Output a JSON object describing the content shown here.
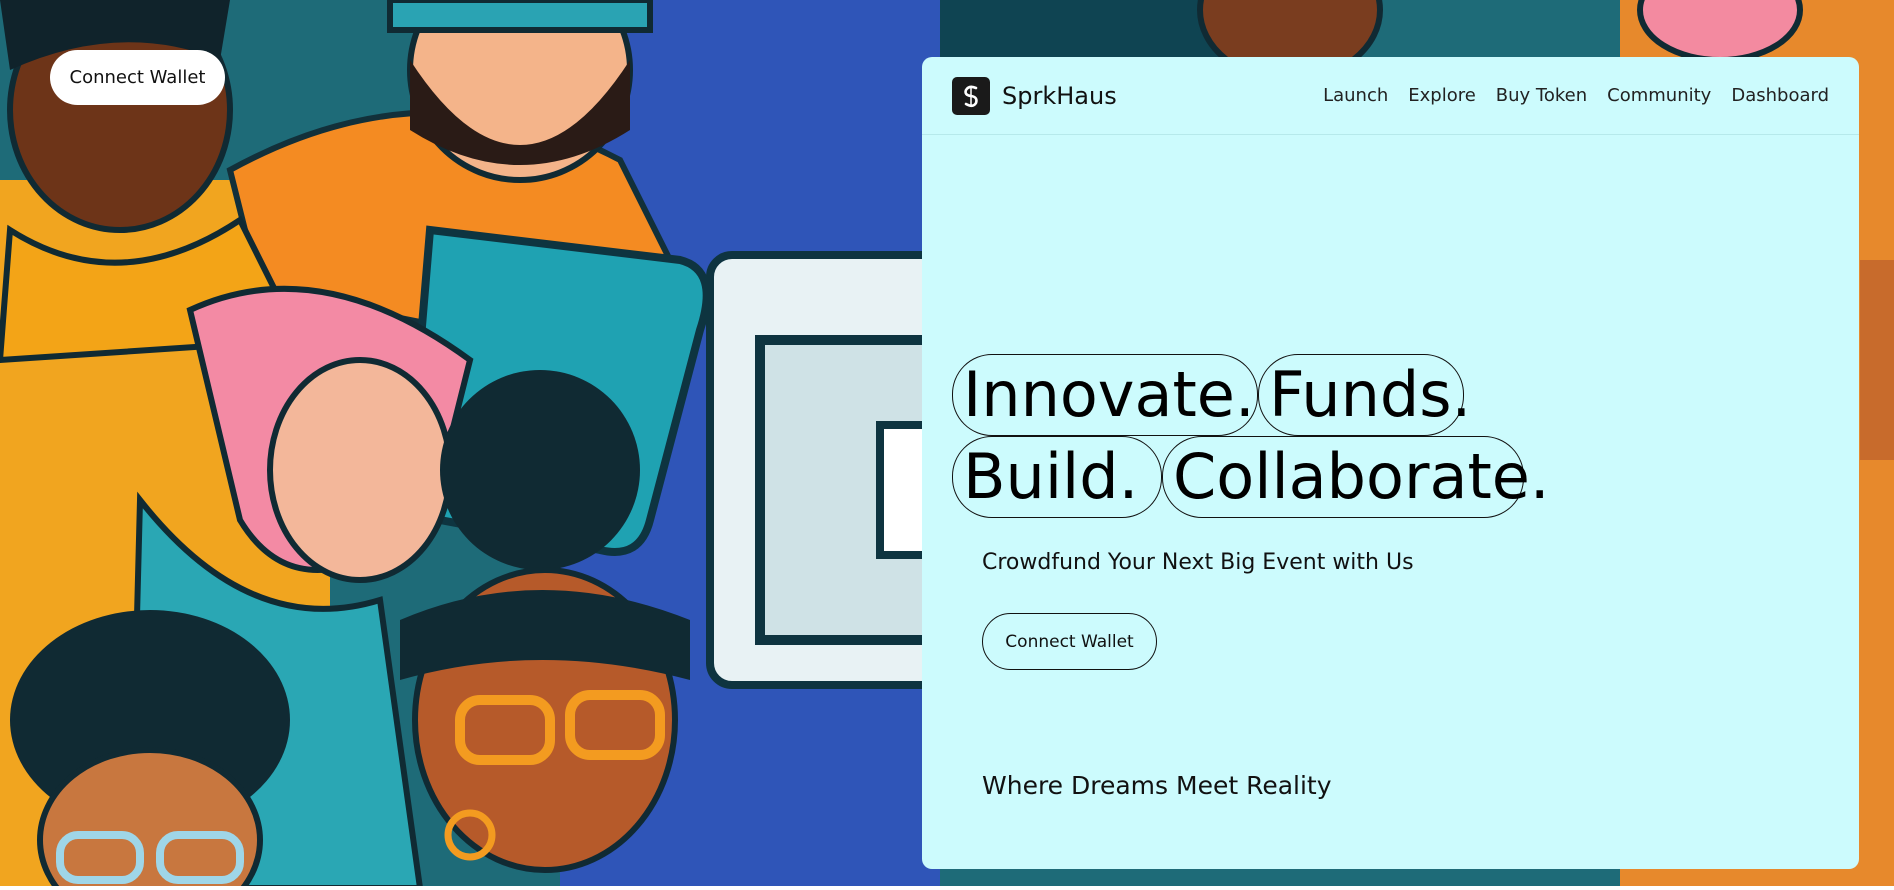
{
  "background": {
    "description_icon": "illustrated-crowd-image"
  },
  "corner_button": {
    "label": "Connect Wallet"
  },
  "brand": {
    "name": "SprkHaus",
    "logo_icon": "s-logo-icon"
  },
  "nav": {
    "items": [
      {
        "label": "Launch"
      },
      {
        "label": "Explore"
      },
      {
        "label": "Buy Token"
      },
      {
        "label": "Community"
      },
      {
        "label": "Dashboard"
      }
    ]
  },
  "hero": {
    "words": [
      "Innovate.",
      "Funds.",
      "Build.",
      "Collaborate."
    ],
    "subtitle": "Crowdfund Your Next Big Event with Us",
    "cta_label": "Connect Wallet",
    "tagline": "Where Dreams Meet Reality"
  },
  "colors": {
    "panel": "#ccfbfd",
    "text": "#111111",
    "logo_bg": "#1a1a1a"
  }
}
